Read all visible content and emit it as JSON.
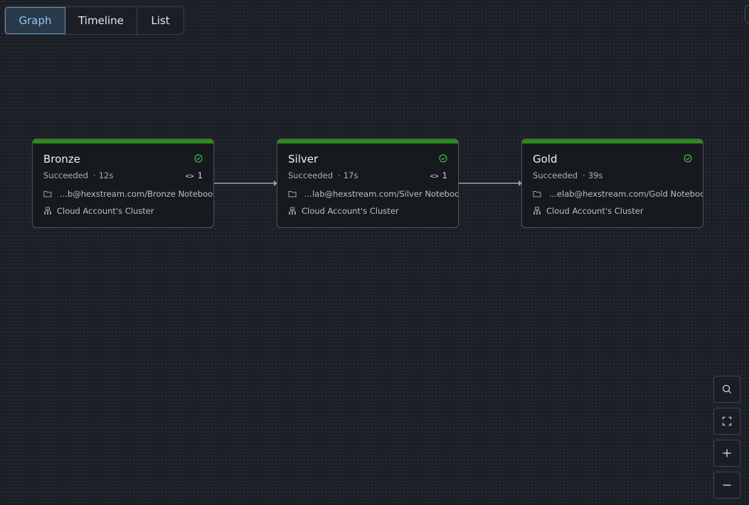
{
  "view_tabs": [
    {
      "label": "Graph",
      "active": true
    },
    {
      "label": "Timeline",
      "active": false
    },
    {
      "label": "List",
      "active": false
    }
  ],
  "tasks": [
    {
      "title": "Bronze",
      "status": "Succeeded",
      "duration": "12s",
      "runs": "1",
      "path": "...b@hexstream.com/Bronze Notebook",
      "cluster": "Cloud Account's Cluster",
      "status_icon": "check-circle-icon"
    },
    {
      "title": "Silver",
      "status": "Succeeded",
      "duration": "17s",
      "runs": "1",
      "path": "...lab@hexstream.com/Silver Notebook",
      "cluster": "Cloud Account's Cluster",
      "status_icon": "check-circle-icon"
    },
    {
      "title": "Gold",
      "status": "Succeeded",
      "duration": "39s",
      "runs": "",
      "path": "...elab@hexstream.com/Gold Notebook",
      "cluster": "Cloud Account's Cluster",
      "status_icon": "check-circle-icon"
    }
  ],
  "zoom_controls": [
    "search-icon",
    "fit-view-icon",
    "zoom-in-icon",
    "zoom-out-icon"
  ],
  "colors": {
    "success": "#2e8a1e",
    "check": "#3fb950",
    "active_tab": "#8fc4f0",
    "background": "#1b1f25"
  }
}
